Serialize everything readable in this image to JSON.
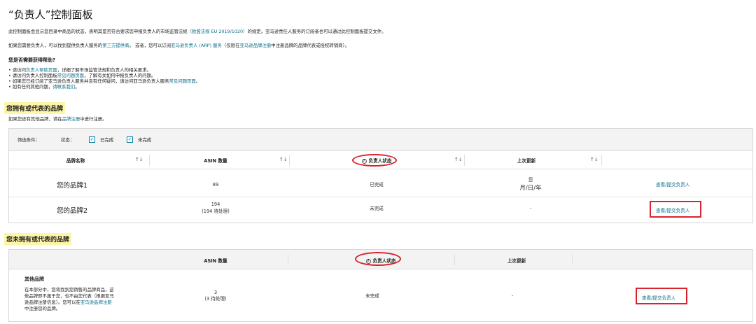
{
  "page_title": "“负责人”控制面板",
  "intro": {
    "line1_pre": "此控制面板会显示您目录中商品的状态，表明其是否符合要求您申报负责人的市场监管法规",
    "line1_link": "（欧盟法规 EU 2019/1020）",
    "line1_post": "的规定。亚马逊责任人服务的订阅者也可以通过此控制面板提交文件。",
    "line2_pre": "如果您需要负责人，可以找到提供负责人服务的",
    "line2_link1": "第三方提供商",
    "line2_mid": "。 或者，您可以订阅",
    "line2_link2": "亚马逊负责人 (ARP) 服务",
    "line2_mid2": "（仅限在",
    "line2_link3": "亚马逊品牌注册",
    "line2_post": "中注册品牌的品牌代表或授权转销商）。"
  },
  "help": {
    "heading": "您是否需要获得帮助?",
    "items": [
      {
        "pre": "• 请访问",
        "link": "负责人帮助页面",
        "post": "，详细了解市场监管法规和负责人的相关要求。"
      },
      {
        "pre": "• 请访问负责人控制面板",
        "link": "常见问题页面",
        "post": "，了解有关如何申报负责人的问题。"
      },
      {
        "pre": "• 如果您已经订阅了亚马逊负责人服务并且有任何疑问，请访问亚马逊负责人服务",
        "link": "常见问题页面",
        "post": "。"
      },
      {
        "pre": "• 如有任何其他问题，",
        "link": "请联系我们",
        "post": "。"
      }
    ]
  },
  "section1": {
    "heading": "您拥有或代表的品牌",
    "sub_pre": "如果您还有其他品牌，请在",
    "sub_link": "品牌注册",
    "sub_post": "中进行注册。"
  },
  "filter": {
    "label": "筛选条件：",
    "status_label": "状态：",
    "options": [
      {
        "label": "已完成",
        "checked": true
      },
      {
        "label": "未完成",
        "checked": true
      }
    ]
  },
  "table1": {
    "headers": [
      "品牌名称",
      "ASIN 数量",
      "负责人状态",
      "上次更新"
    ],
    "sort_icon": "↑↓",
    "rows": [
      {
        "brand": "您的品牌1",
        "asin": "89",
        "asin_pending": "",
        "status": "已完成",
        "updated_line1": "您",
        "updated_line2": "月/日/年",
        "action": "查看/提交负责人",
        "highlighted": false
      },
      {
        "brand": "您的品牌2",
        "asin": "194",
        "asin_pending": "(194 待处理)",
        "status": "未完成",
        "updated_line1": "-",
        "updated_line2": "",
        "action": "查看/提交负责人",
        "highlighted": true
      }
    ]
  },
  "section2": {
    "heading": "您未拥有或代表的品牌"
  },
  "table2": {
    "headers": [
      "ASIN 数量",
      "负责人状态",
      "上次更新"
    ],
    "row": {
      "title": "其他品牌",
      "desc1": "在本部分中，您将找到您销售的品牌商品，这",
      "desc2": "些品牌即不属于您，也不由您代表（根据亚马",
      "desc3_pre": "逊品牌注册信息）。您可以在",
      "desc3_link": "亚马逊品牌注册",
      "desc4": "中注册您的品牌。",
      "asin": "3",
      "asin_pending": "(3 待处理)",
      "status": "未完成",
      "updated": "-",
      "action": "查看/提交负责人"
    }
  },
  "colors": {
    "link": "#0a6e8a",
    "highlight": "#fdf5a8",
    "annotation_red": "#d9232e"
  }
}
